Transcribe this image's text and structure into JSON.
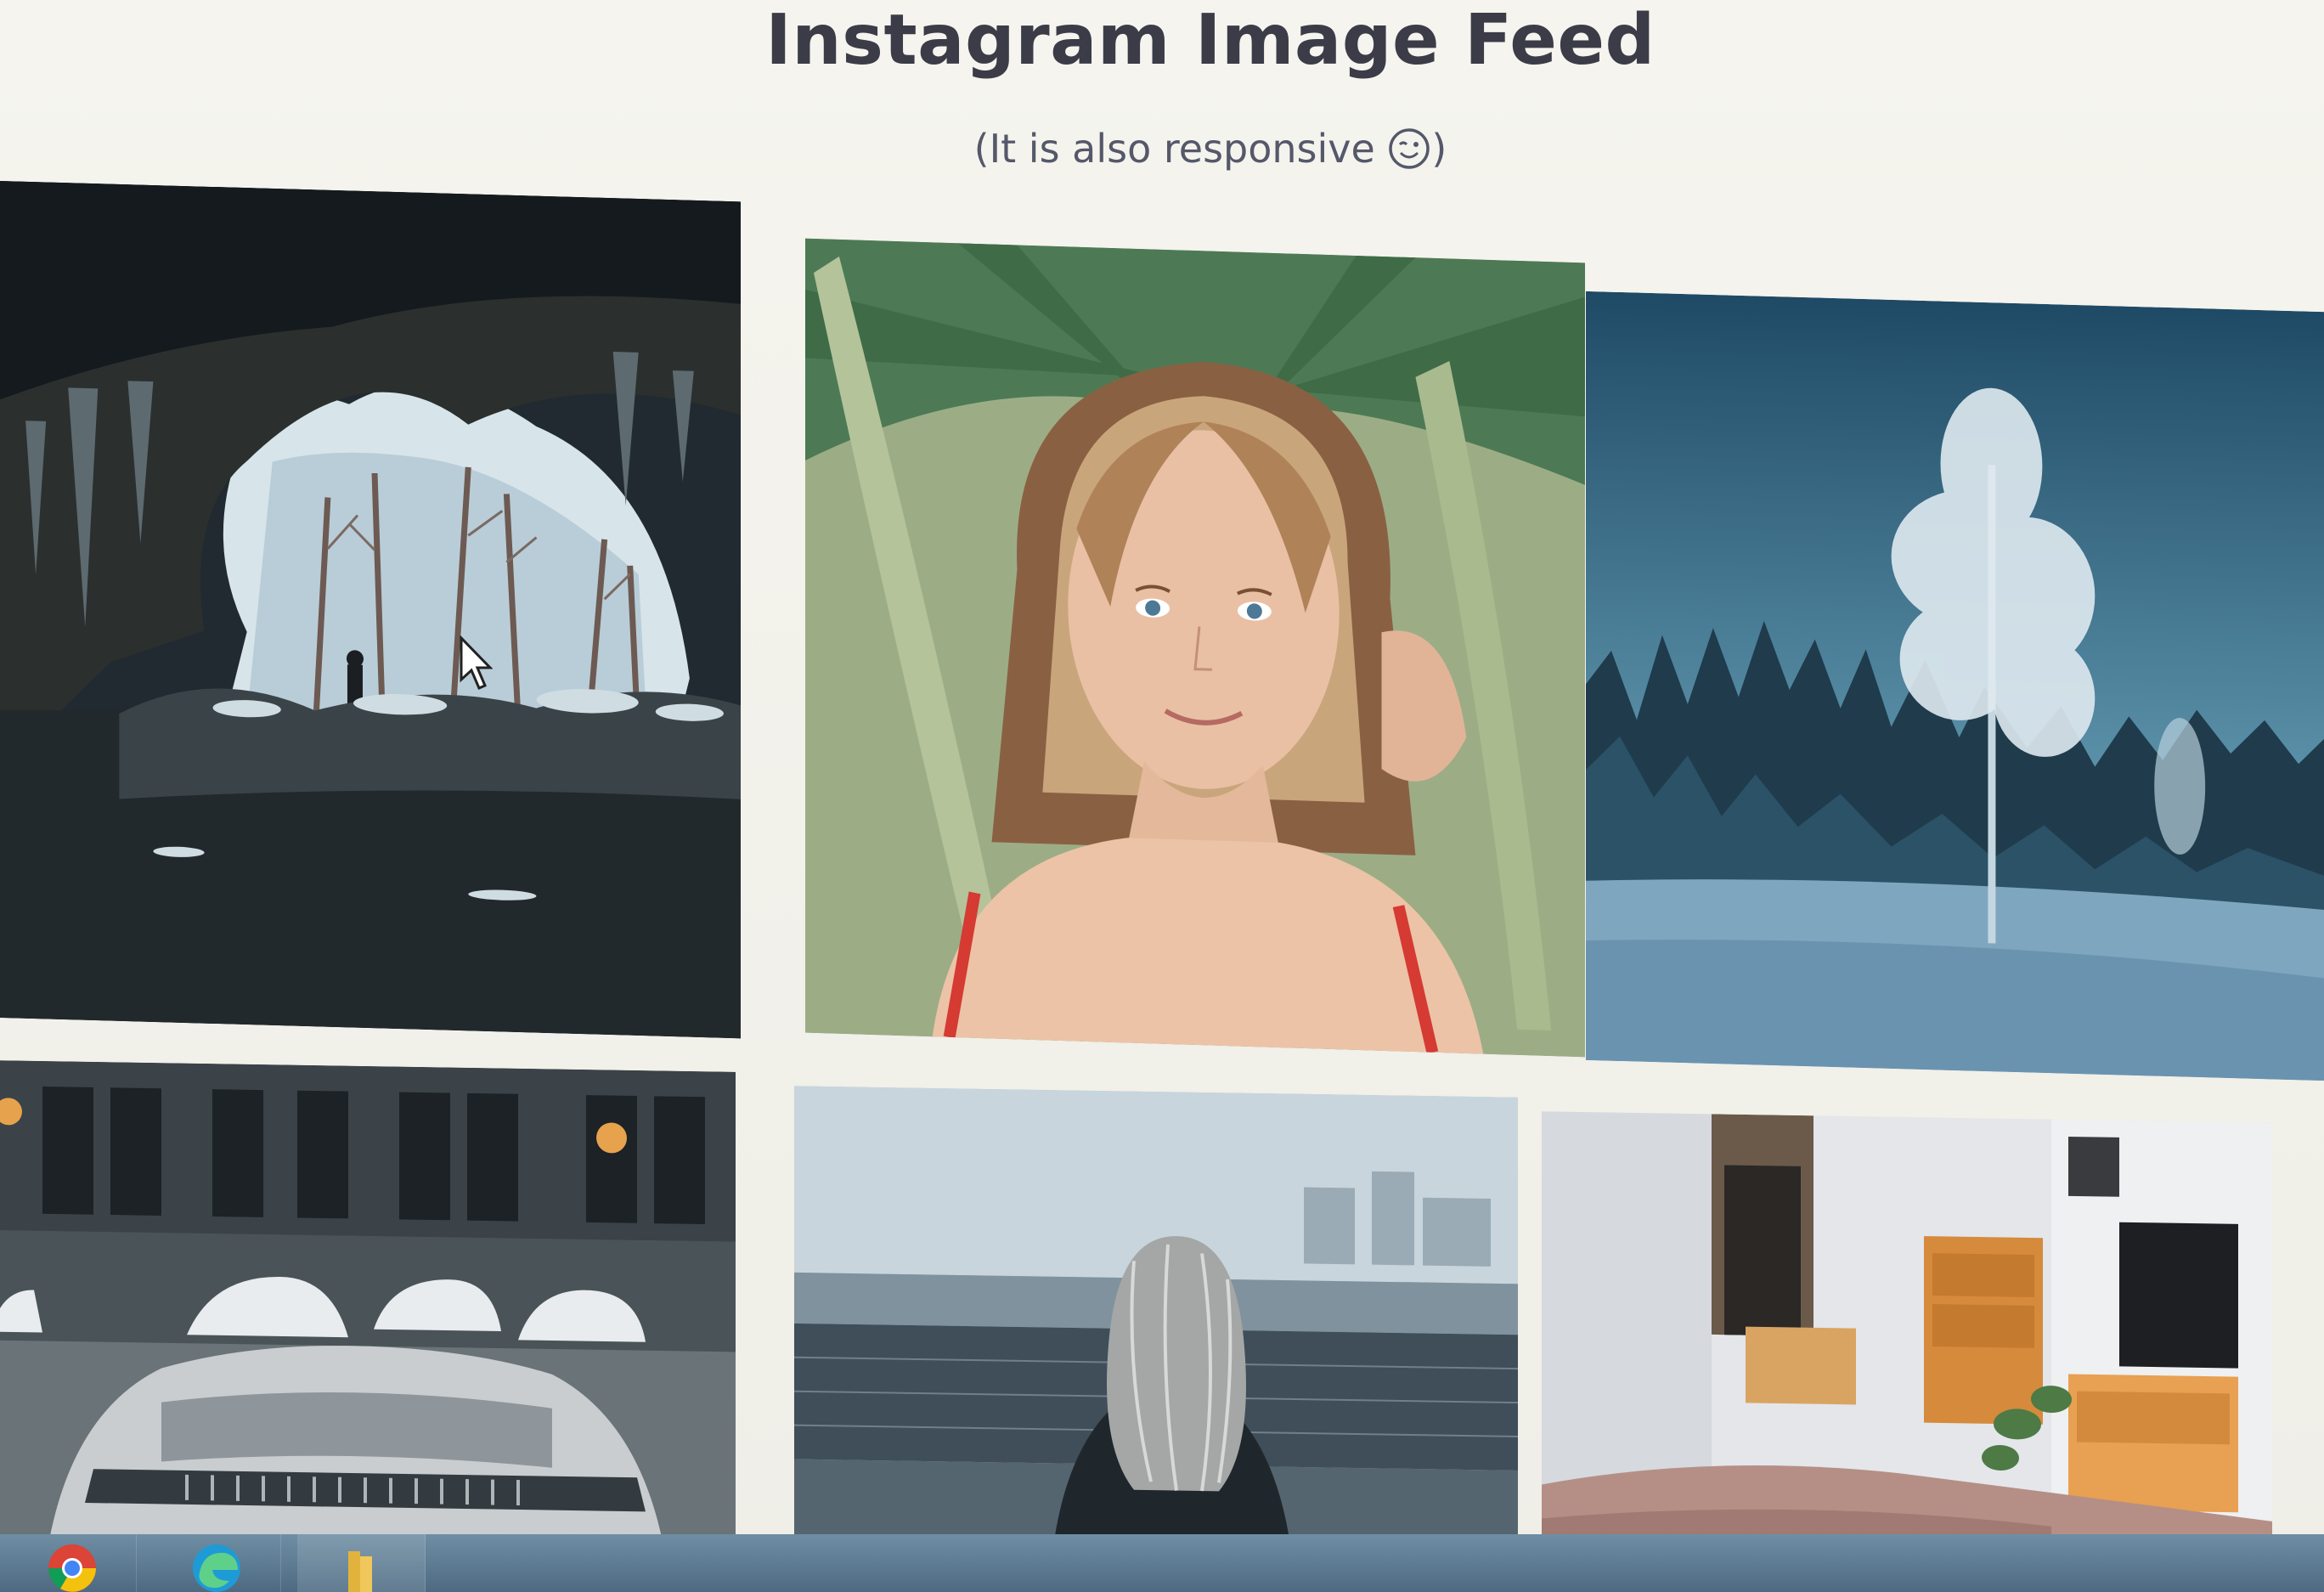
{
  "page": {
    "title": "Instagram Image Feed",
    "subtitle": "(It is also responsive "
  },
  "icons": {
    "subtitle_emoji": "winking-face-icon",
    "cursor": "mouse-pointer-icon",
    "taskbar": [
      "chrome-icon",
      "edge-icon",
      "file-explorer-icon"
    ]
  },
  "feed": {
    "images": [
      {
        "subject": "snowy cave entrance with a person standing outside"
      },
      {
        "subject": "blonde woman under palm leaves"
      },
      {
        "subject": "frosted tree in a blue winter forest"
      },
      {
        "subject": "silver sports car on a snowy street with canal houses"
      },
      {
        "subject": "woman with long hair looking at a misty harbor"
      },
      {
        "subject": "bright bedroom with wooden furniture and a plant"
      }
    ]
  }
}
